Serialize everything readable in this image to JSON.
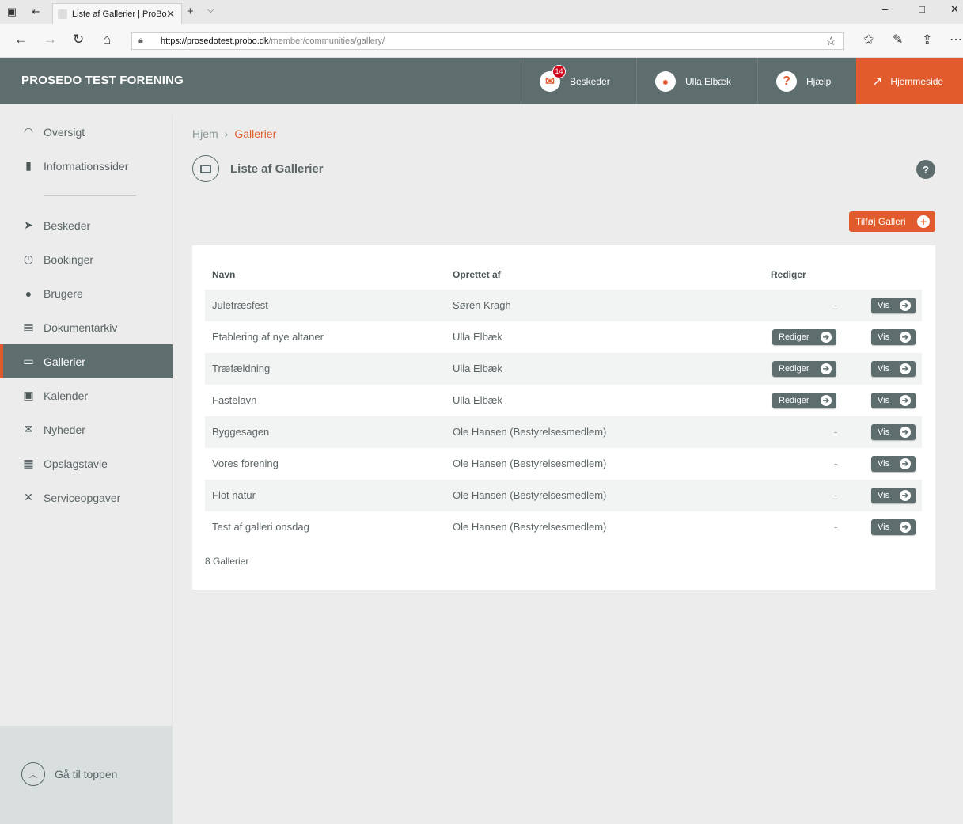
{
  "browser": {
    "tab_title": "Liste af Gallerier | ProBo",
    "url_domain": "https://prosedotest.probo.dk",
    "url_path": "/member/communities/gallery/"
  },
  "header": {
    "brand": "PROSEDO TEST FORENING",
    "messages_label": "Beskeder",
    "messages_count": "14",
    "user_label": "Ulla Elbæk",
    "help_label": "Hjælp",
    "homepage_label": "Hjemmeside"
  },
  "sidebar": {
    "items": [
      {
        "label": "Oversigt",
        "icon": "gauge-icon"
      },
      {
        "label": "Informationssider",
        "icon": "book-icon"
      },
      {
        "label": "Beskeder",
        "icon": "paper-plane-icon"
      },
      {
        "label": "Bookinger",
        "icon": "clock-icon"
      },
      {
        "label": "Brugere",
        "icon": "user-icon"
      },
      {
        "label": "Dokumentarkiv",
        "icon": "archive-icon"
      },
      {
        "label": "Gallerier",
        "icon": "gallery-icon"
      },
      {
        "label": "Kalender",
        "icon": "calendar-icon"
      },
      {
        "label": "Nyheder",
        "icon": "envelope-icon"
      },
      {
        "label": "Opslagstavle",
        "icon": "board-icon"
      },
      {
        "label": "Serviceopgaver",
        "icon": "tools-icon"
      }
    ],
    "active": "Gallerier",
    "to_top": "Gå til toppen"
  },
  "breadcrumb": {
    "home": "Hjem",
    "current": "Gallerier"
  },
  "page": {
    "title": "Liste af Gallerier",
    "add_button": "Tilføj Galleri"
  },
  "table": {
    "headers": {
      "name": "Navn",
      "created_by": "Oprettet af",
      "edit": "Rediger"
    },
    "edit_label": "Rediger",
    "view_label": "Vis",
    "rows": [
      {
        "name": "Juletræsfest",
        "created_by": "Søren Kragh",
        "editable": false
      },
      {
        "name": "Etablering af nye altaner",
        "created_by": "Ulla Elbæk",
        "editable": true
      },
      {
        "name": "Træfældning",
        "created_by": "Ulla Elbæk",
        "editable": true
      },
      {
        "name": "Fastelavn",
        "created_by": "Ulla Elbæk",
        "editable": true
      },
      {
        "name": "Byggesagen",
        "created_by": "Ole Hansen (Bestyrelsesmedlem)",
        "editable": false
      },
      {
        "name": "Vores forening",
        "created_by": "Ole Hansen (Bestyrelsesmedlem)",
        "editable": false
      },
      {
        "name": "Flot natur",
        "created_by": "Ole Hansen (Bestyrelsesmedlem)",
        "editable": false
      },
      {
        "name": "Test af galleri onsdag",
        "created_by": "Ole Hansen (Bestyrelsesmedlem)",
        "editable": false
      }
    ],
    "no_edit_mark": "-",
    "count_text": "8 Gallerier"
  },
  "colors": {
    "accent": "#e25b2c",
    "header_bg": "#5e6d6e",
    "sidebar_bg": "#ececec"
  }
}
